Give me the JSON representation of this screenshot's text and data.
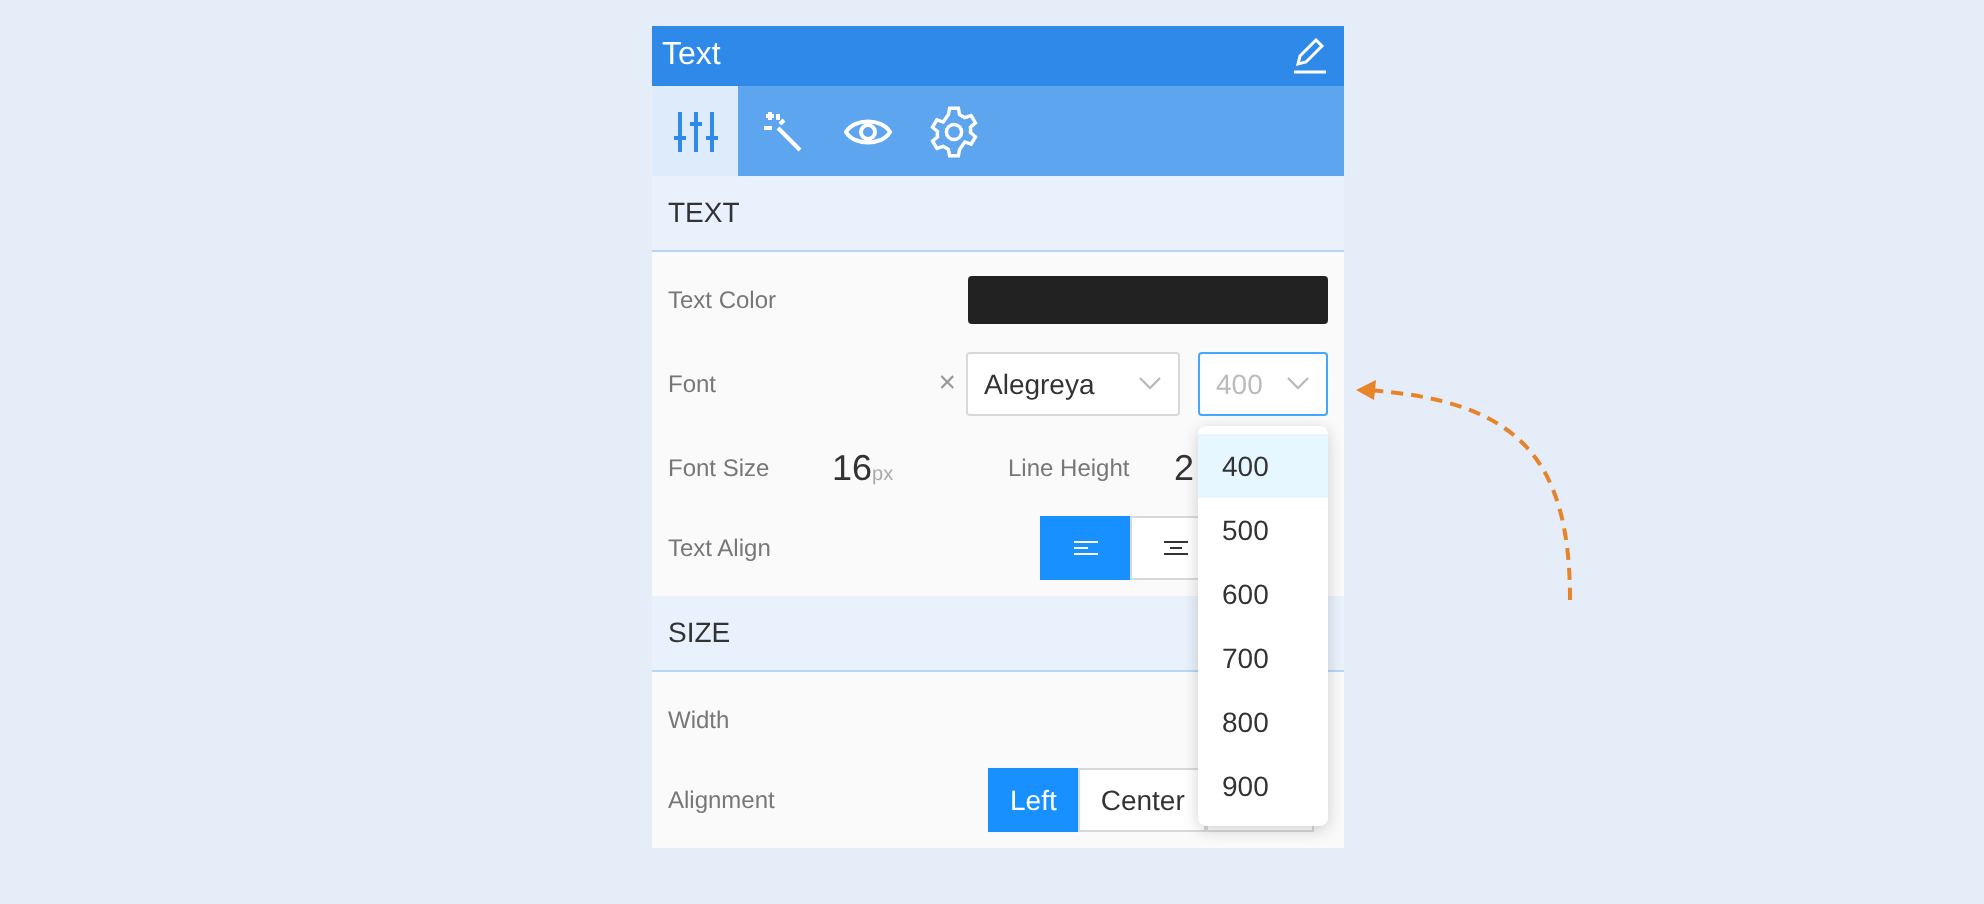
{
  "panel": {
    "title": "Text"
  },
  "tabs": [
    {
      "kind": "sliders",
      "selected": true
    },
    {
      "kind": "wand",
      "selected": false
    },
    {
      "kind": "eye",
      "selected": false
    },
    {
      "kind": "gear",
      "selected": false
    }
  ],
  "sections": [
    {
      "title": "TEXT",
      "rows": [
        {
          "kind": "color",
          "label": "Text Color",
          "color": "#222222"
        },
        {
          "kind": "font",
          "label": "Font",
          "clear": "×",
          "font": "Alegreya",
          "weight": "400",
          "open": true
        },
        {
          "kind": "metrics",
          "items": [
            {
              "label": "Font Size",
              "value": "16",
              "unit": "px"
            },
            {
              "label": "Line Height",
              "value": "2"
            }
          ]
        },
        {
          "kind": "icon-buttons",
          "label": "Text Align",
          "buttons": [
            {
              "kind": "align-left",
              "selected": true
            },
            {
              "kind": "align-center",
              "selected": false
            }
          ]
        }
      ]
    },
    {
      "title": "SIZE",
      "rows": [
        {
          "kind": "plain",
          "label": "Width"
        },
        {
          "kind": "text-buttons",
          "label": "Alignment",
          "buttons": [
            {
              "label": "Left",
              "selected": true
            },
            {
              "label": "Center",
              "selected": false
            },
            {
              "selected": false
            }
          ]
        }
      ]
    }
  ],
  "weight_menu": {
    "options": [
      {
        "label": "400",
        "selected": true
      },
      {
        "label": "500",
        "selected": false
      },
      {
        "label": "600",
        "selected": false
      },
      {
        "label": "700",
        "selected": false
      },
      {
        "label": "800",
        "selected": false
      },
      {
        "label": "900",
        "selected": false
      }
    ]
  }
}
